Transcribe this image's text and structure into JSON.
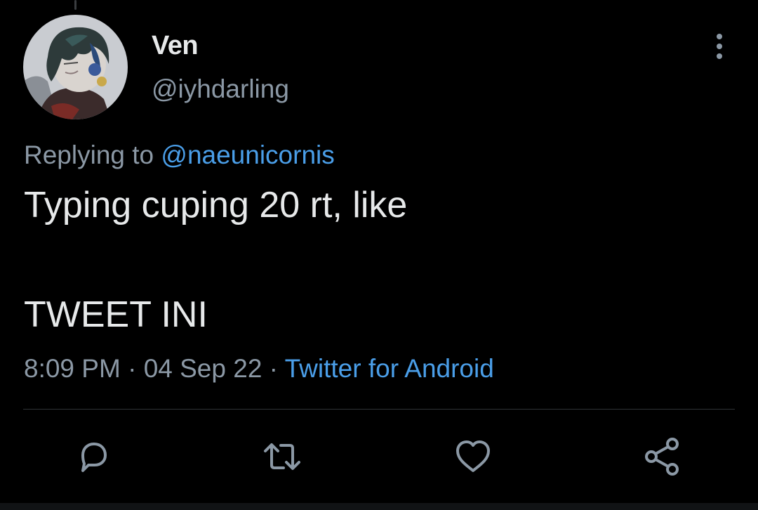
{
  "tweet": {
    "author": {
      "display_name": "Ven",
      "handle": "@iyhdarling"
    },
    "reply_context": {
      "prefix": "Replying to ",
      "mention": "@naeunicornis"
    },
    "text_lines": [
      "Typing cuping 20 rt, like",
      "TWEET INI"
    ],
    "time": "8:09 PM",
    "date": "04 Sep 22",
    "separator": " · ",
    "source": "Twitter for Android"
  },
  "icons": {
    "more": "more-vertical-icon",
    "reply": "reply-icon",
    "retweet": "retweet-icon",
    "like": "heart-icon",
    "share": "share-icon"
  },
  "colors": {
    "background": "#000000",
    "primary_text": "#e7e9ea",
    "secondary_text": "#8b98a5",
    "link": "#4a9ee8",
    "divider": "#2f3336"
  }
}
